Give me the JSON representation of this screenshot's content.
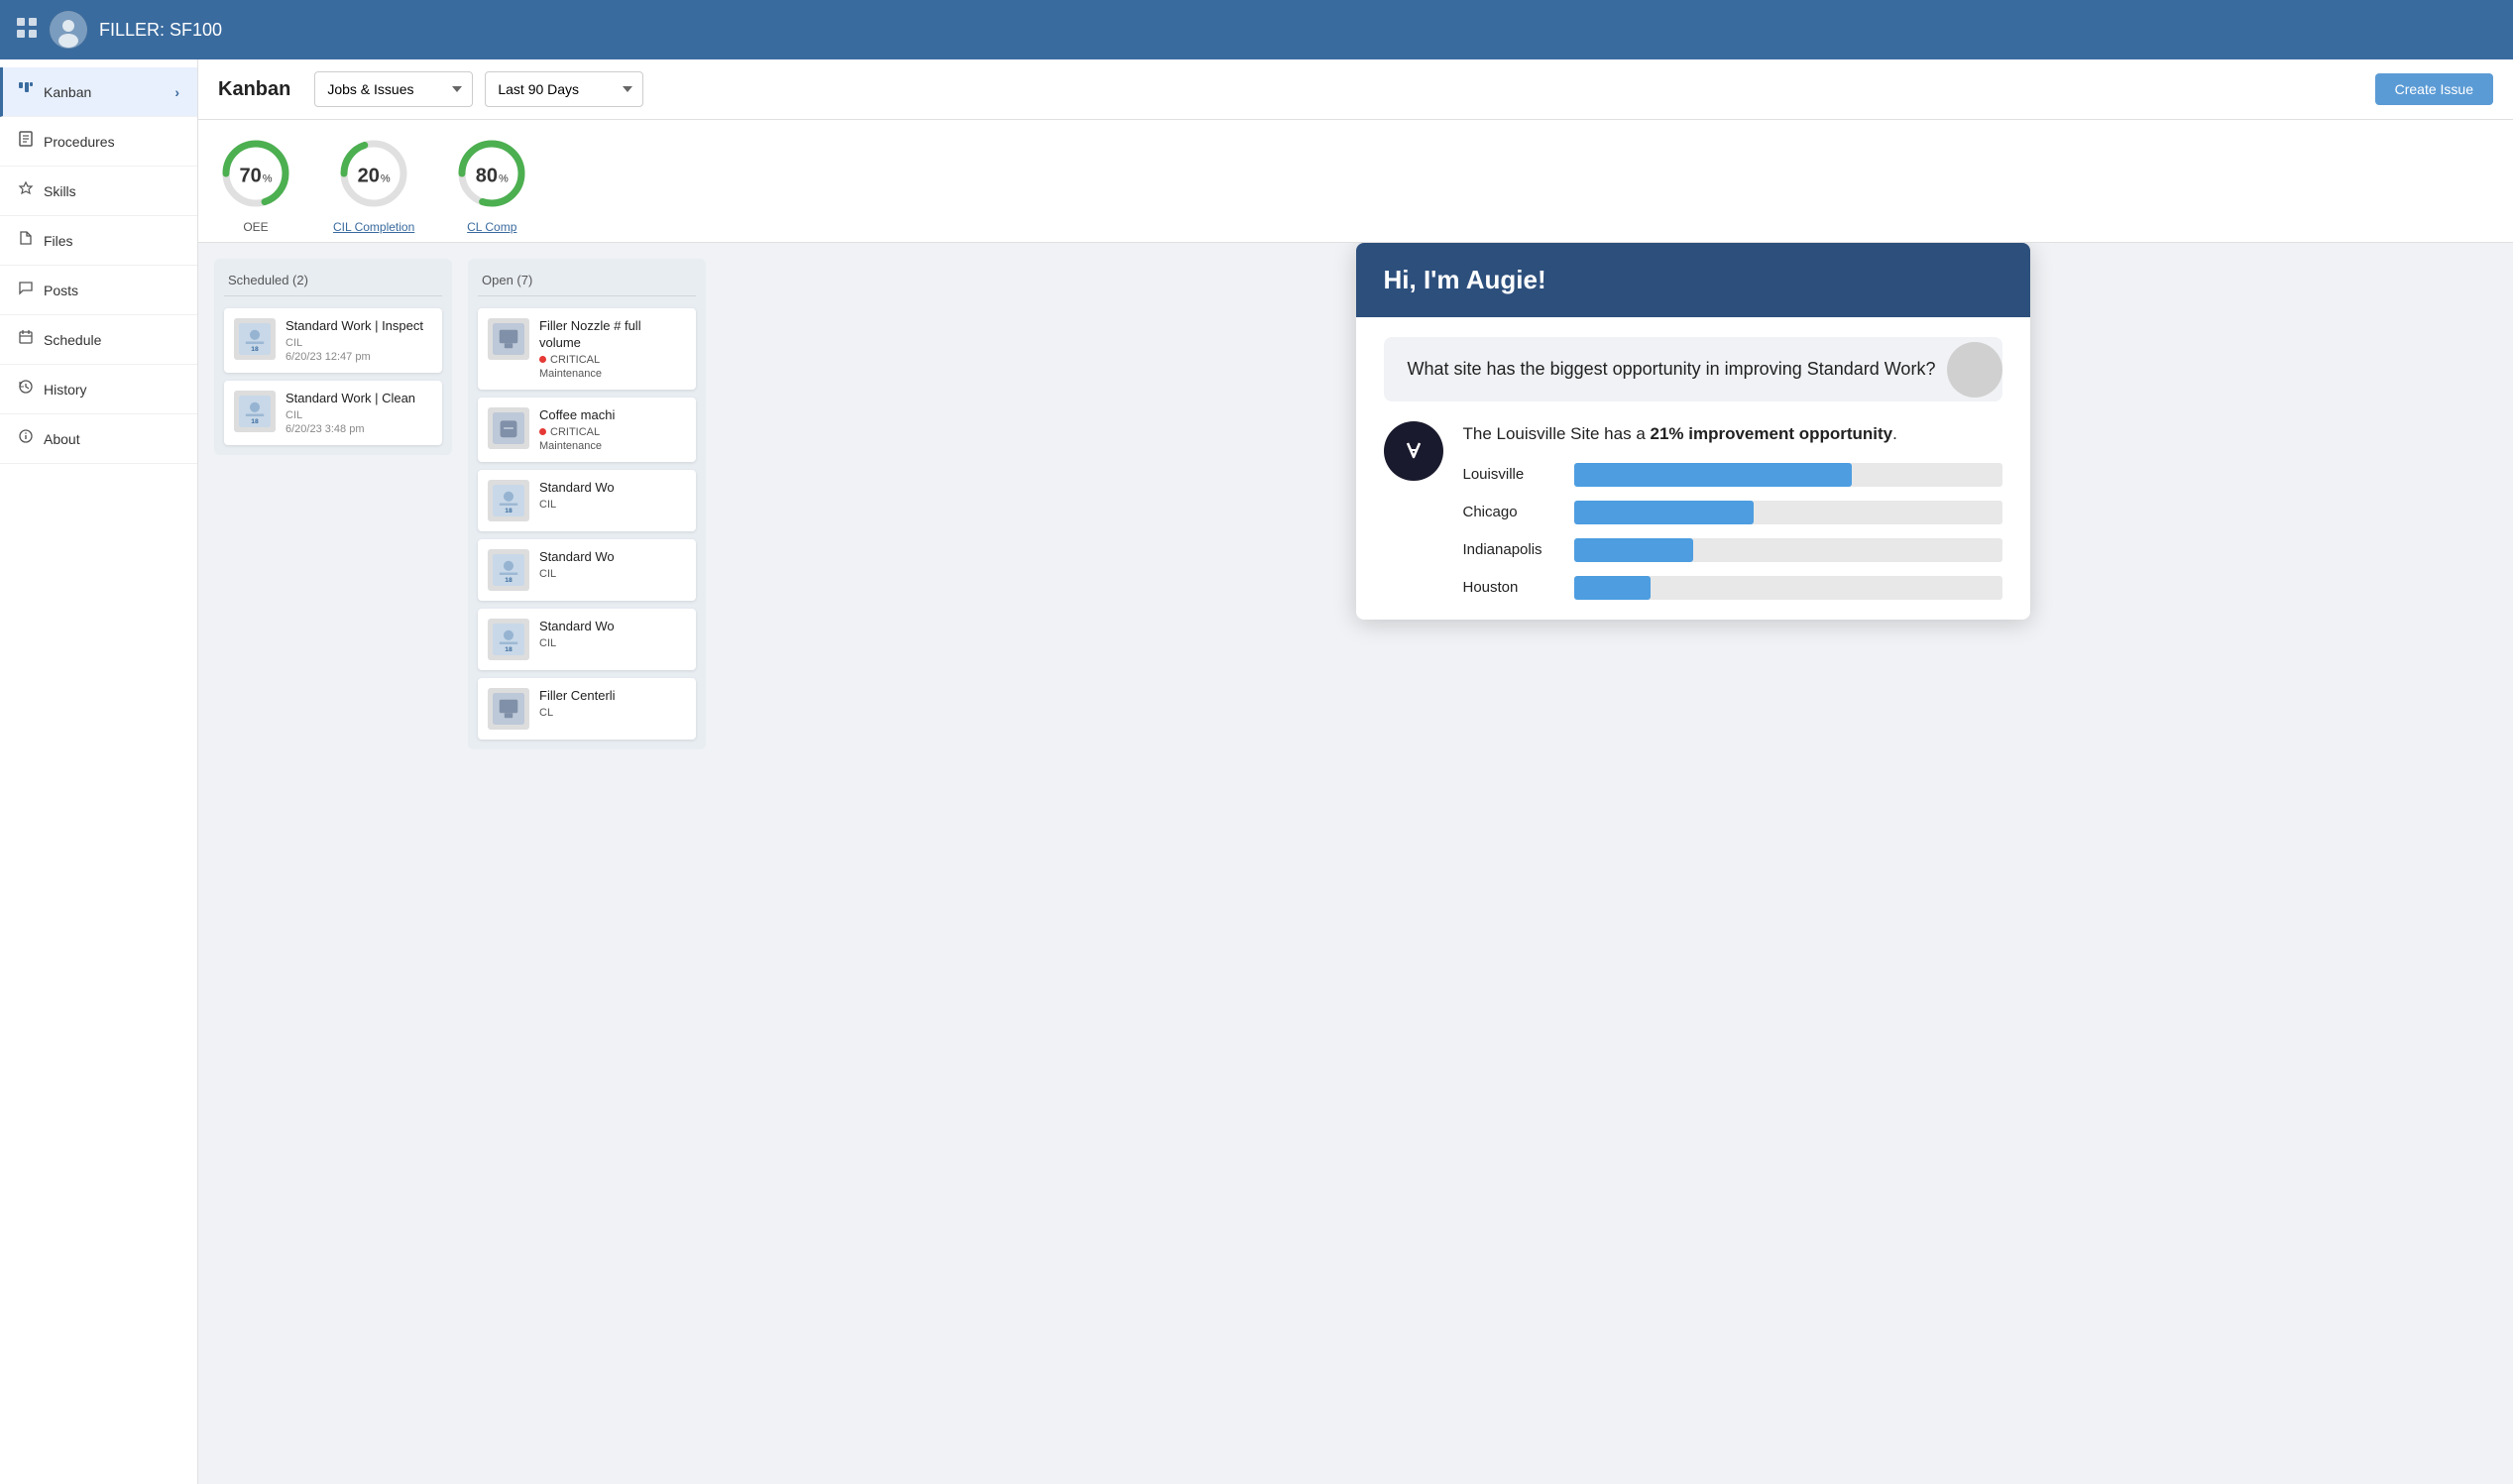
{
  "header": {
    "title": "FILLER: SF100",
    "grid_icon": "⊞"
  },
  "sidebar": {
    "items": [
      {
        "id": "kanban",
        "label": "Kanban",
        "icon": "▦",
        "active": true,
        "arrow": "›"
      },
      {
        "id": "procedures",
        "label": "Procedures",
        "icon": "📋",
        "active": false
      },
      {
        "id": "skills",
        "label": "Skills",
        "icon": "🎓",
        "active": false
      },
      {
        "id": "files",
        "label": "Files",
        "icon": "📄",
        "active": false
      },
      {
        "id": "posts",
        "label": "Posts",
        "icon": "💬",
        "active": false
      },
      {
        "id": "schedule",
        "label": "Schedule",
        "icon": "📅",
        "active": false
      },
      {
        "id": "history",
        "label": "History",
        "icon": "🕐",
        "active": false
      },
      {
        "id": "about",
        "label": "About",
        "icon": "ℹ",
        "active": false
      }
    ]
  },
  "content_header": {
    "title": "Kanban",
    "filter_type": "Jobs & Issues",
    "filter_period": "Last 90 Days",
    "create_button": "Create Issue"
  },
  "metrics": [
    {
      "id": "oee",
      "value": 70,
      "unit": "%",
      "label": "OEE",
      "color": "#4caf50",
      "track": "#e0e0e0"
    },
    {
      "id": "cil_completion",
      "value": 20,
      "unit": "%",
      "label": "CIL Completion",
      "link": true,
      "color": "#4caf50",
      "track": "#e0e0e0"
    },
    {
      "id": "cl_comp",
      "value": 80,
      "unit": "%",
      "label": "CL Comp",
      "link": true,
      "color": "#4caf50",
      "track": "#e0e0e0"
    }
  ],
  "kanban": {
    "columns": [
      {
        "id": "scheduled",
        "header": "Scheduled (2)",
        "cards": [
          {
            "title": "Standard Work | Inspect",
            "tag": "CIL",
            "date": "6/20/23 12:47 pm",
            "type": "standard"
          },
          {
            "title": "Standard Work | Clean",
            "tag": "CIL",
            "date": "6/20/23 3:48 pm",
            "type": "standard"
          }
        ]
      },
      {
        "id": "open",
        "header": "Open (7)",
        "cards": [
          {
            "title": "Filler Nozzle # full volume",
            "tag": "Maintenance",
            "critical": true,
            "type": "nozzle"
          },
          {
            "title": "Coffee machi",
            "tag": "Maintenance",
            "critical": true,
            "type": "coffee"
          },
          {
            "title": "Standard Wo",
            "tag": "CIL",
            "type": "standard"
          },
          {
            "title": "Standard Wo",
            "tag": "CIL",
            "type": "standard"
          },
          {
            "title": "Standard Wo",
            "tag": "CIL",
            "type": "standard"
          },
          {
            "title": "Filler Centerli",
            "tag": "CL",
            "type": "filler"
          }
        ]
      }
    ]
  },
  "ai_panel": {
    "greeting": "Hi, I'm Augie!",
    "question": "What site has the biggest opportunity in improving Standard Work?",
    "answer_prefix": "The Louisville Site has a ",
    "answer_highlight": "21% improvement opportunity",
    "answer_suffix": ".",
    "bars": [
      {
        "label": "Louisville",
        "value": 65
      },
      {
        "label": "Chicago",
        "value": 42
      },
      {
        "label": "Indianapolis",
        "value": 28
      },
      {
        "label": "Houston",
        "value": 18
      }
    ],
    "bar_color": "#4d9de0"
  }
}
